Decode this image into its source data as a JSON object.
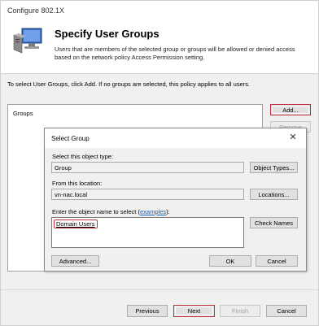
{
  "window": {
    "title": "Configure 802.1X"
  },
  "header": {
    "heading": "Specify User Groups",
    "description": "Users that are members of the selected group or groups will be allowed or denied access based on the network policy Access Permission setting.",
    "icon": "computer-network-icon"
  },
  "main": {
    "instructions": "To select User Groups, click Add. If no groups are selected, this policy applies to all users.",
    "groups_column_header": "Groups",
    "add_label": "Add...",
    "remove_label": "Remove"
  },
  "dialog": {
    "title": "Select Group",
    "object_type_label": "Select this object type:",
    "object_type_value": "Group",
    "object_types_button": "Object Types...",
    "location_label": "From this location:",
    "location_value": "vn-nac.local",
    "locations_button": "Locations...",
    "enter_name_prefix": "Enter the object name to select (",
    "enter_name_link": "examples",
    "enter_name_suffix": "):",
    "entered_name": "Domain Users",
    "check_names_button": "Check Names",
    "advanced_button": "Advanced...",
    "ok_button": "OK",
    "cancel_button": "Cancel"
  },
  "footer": {
    "previous_label": "Previous",
    "next_label": "Next",
    "finish_label": "Finish",
    "cancel_label": "Cancel"
  },
  "colors": {
    "highlight": "#c0303a",
    "link": "#1a5fb4"
  }
}
